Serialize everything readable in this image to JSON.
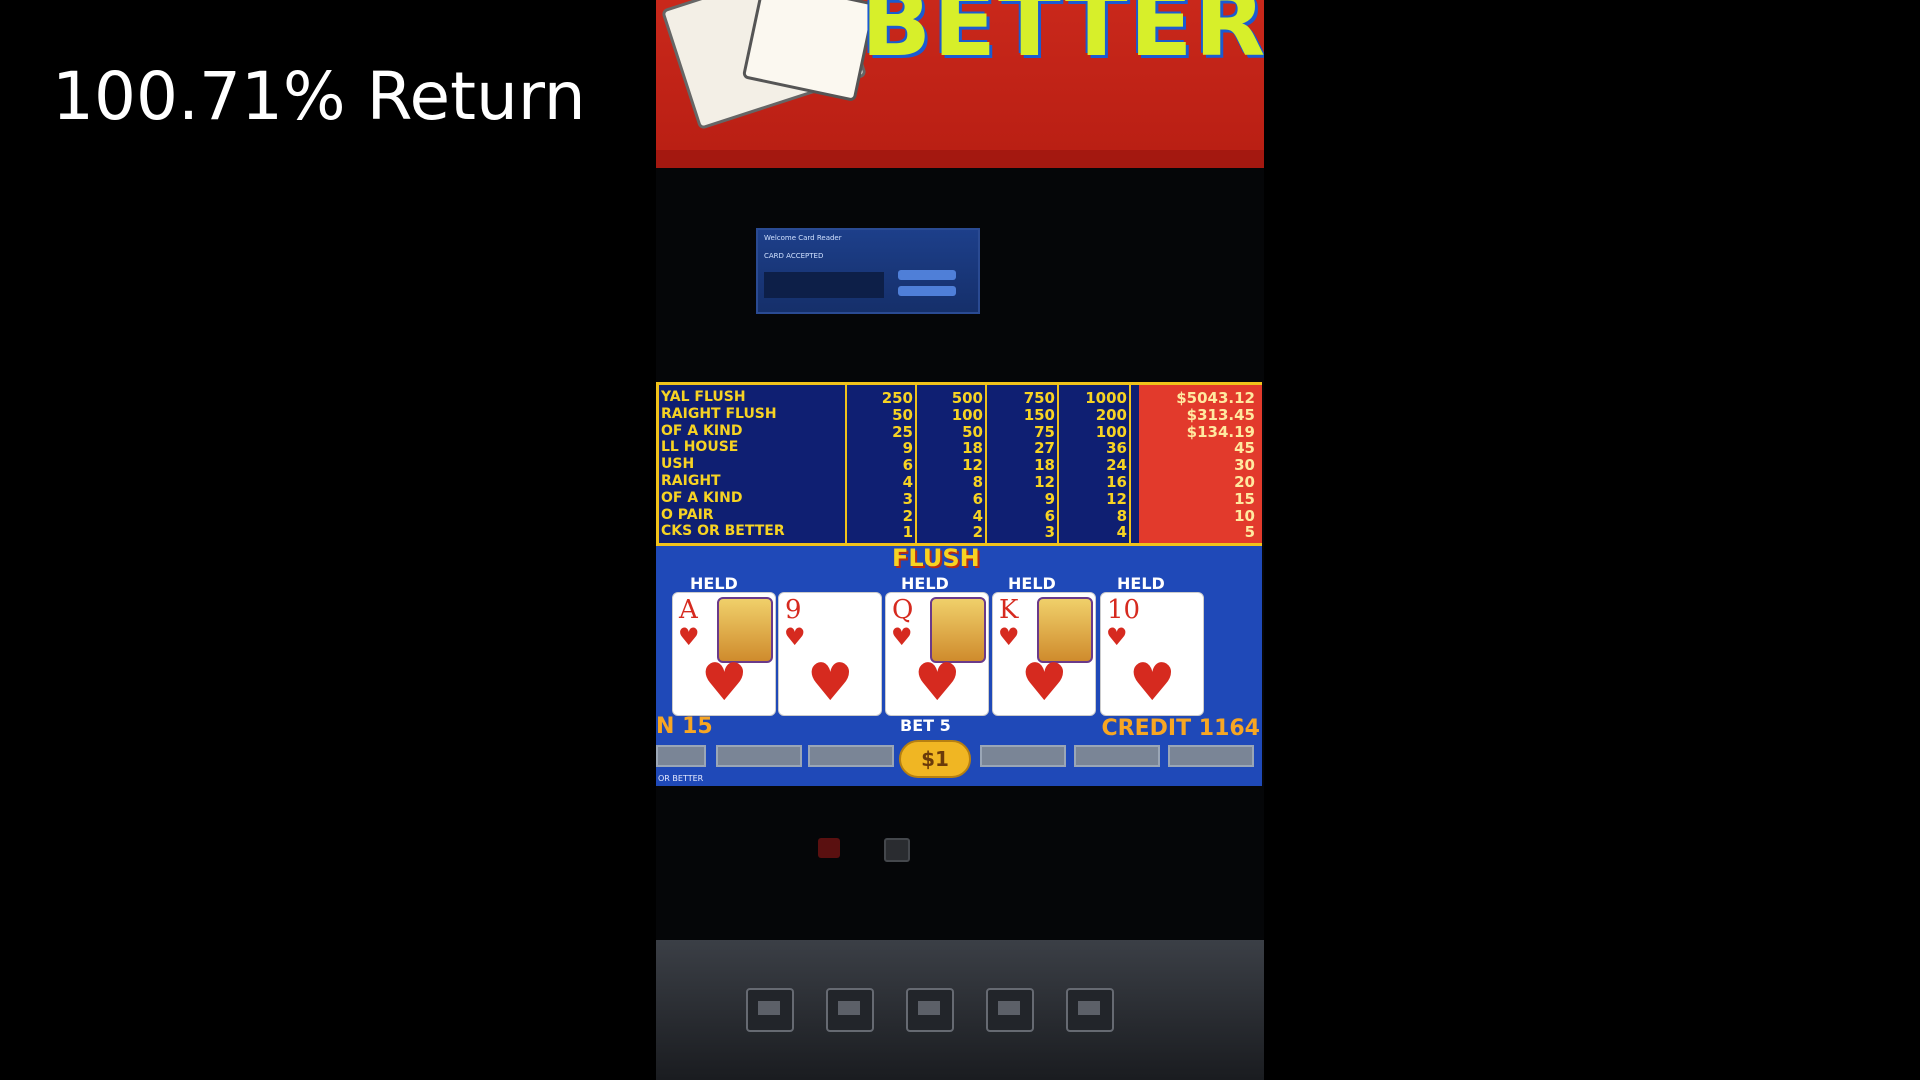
{
  "overlay": {
    "title": "100.71% Return"
  },
  "topper": {
    "game_title": "BETTER"
  },
  "card_reader": {
    "line1": "Welcome Card Reader",
    "line2": "CARD ACCEPTED"
  },
  "paytable": {
    "rows": [
      {
        "name": "YAL FLUSH",
        "c1": "250",
        "c2": "500",
        "c3": "750",
        "c4": "1000",
        "jp": "$5043.12"
      },
      {
        "name": "RAIGHT FLUSH",
        "c1": "50",
        "c2": "100",
        "c3": "150",
        "c4": "200",
        "jp": "$313.45"
      },
      {
        "name": "OF A KIND",
        "c1": "25",
        "c2": "50",
        "c3": "75",
        "c4": "100",
        "jp": "$134.19"
      },
      {
        "name": "LL HOUSE",
        "c1": "9",
        "c2": "18",
        "c3": "27",
        "c4": "36",
        "jp": "45"
      },
      {
        "name": "USH",
        "c1": "6",
        "c2": "12",
        "c3": "18",
        "c4": "24",
        "jp": "30"
      },
      {
        "name": "RAIGHT",
        "c1": "4",
        "c2": "8",
        "c3": "12",
        "c4": "16",
        "jp": "20"
      },
      {
        "name": "OF A KIND",
        "c1": "3",
        "c2": "6",
        "c3": "9",
        "c4": "12",
        "jp": "15"
      },
      {
        "name": "O PAIR",
        "c1": "2",
        "c2": "4",
        "c3": "6",
        "c4": "8",
        "jp": "10"
      },
      {
        "name": "CKS OR BETTER",
        "c1": "1",
        "c2": "2",
        "c3": "3",
        "c4": "4",
        "jp": "5"
      }
    ]
  },
  "hand": {
    "result": "FLUSH",
    "held_label": "HELD",
    "cards": [
      {
        "rank": "A",
        "suit": "♥",
        "held": true,
        "face": true
      },
      {
        "rank": "9",
        "suit": "♥",
        "held": false,
        "face": false
      },
      {
        "rank": "Q",
        "suit": "♥",
        "held": true,
        "face": true
      },
      {
        "rank": "K",
        "suit": "♥",
        "held": true,
        "face": true
      },
      {
        "rank": "10",
        "suit": "♥",
        "held": true,
        "face": false
      }
    ]
  },
  "status": {
    "win": "N 15",
    "bet": "BET 5",
    "credit": "CREDIT 1164",
    "denomination": "$1",
    "game_name": "OR BETTER"
  },
  "colors": {
    "paytable_text": "#f7d323",
    "jackpot_bg": "#e23a2c",
    "screen_bg": "#1f49b8",
    "heart": "#d62a1f"
  }
}
